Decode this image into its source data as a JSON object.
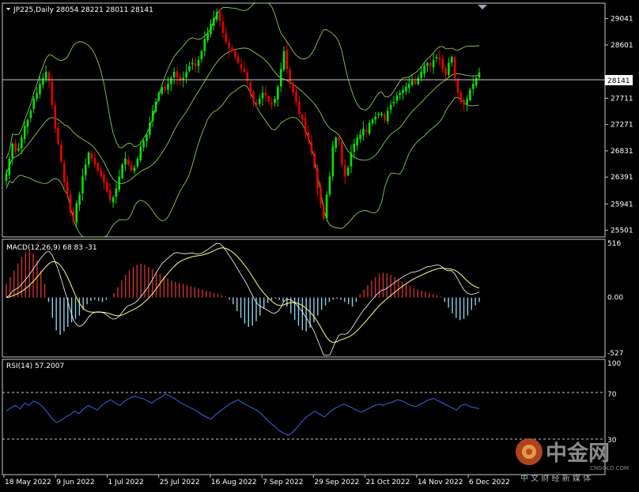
{
  "colors": {
    "background": "#000000",
    "frame": "#c8c8c8",
    "bull_candle": "#00e600",
    "bear_candle": "#e60000",
    "bollinger": "#9be05a",
    "macd_pos_hist": "#d03030",
    "macd_neg_hist": "#8ccfe6",
    "macd_signal": "#ffff7a",
    "macd_line": "#ffffff",
    "rsi_line": "#3a62e8",
    "price_line": "#c8c8c8"
  },
  "header": {
    "price": "JP225,Daily  28054 28221 28011 28141",
    "macd": "MACD(12,26,9) 68 83 -31",
    "rsi": "RSI(14) 57.2007"
  },
  "price_marker": "28141",
  "watermark": {
    "name": "中金网",
    "domain": "CNGOLD.COM",
    "tagline": "中 文 财 经 新 媒 体"
  },
  "chart_data": [
    {
      "type": "candlestick",
      "title": "JP225,Daily",
      "symbol": "JP225",
      "timeframe": "Daily",
      "last_ohlc": {
        "open": 28054,
        "high": 28221,
        "low": 28011,
        "close": 28141
      },
      "yticks": [
        "29041",
        "28601",
        "27711",
        "27271",
        "26831",
        "26391",
        "25941",
        "25501"
      ],
      "ylim": [
        25390,
        29300
      ],
      "xticks": [
        "18 May 2022",
        "9 Jun 2022",
        "1 Jul 2022",
        "25 Jul 2022",
        "16 Aug 2022",
        "7 Sep 2022",
        "29 Sep 2022",
        "21 Oct 2022",
        "14 Nov 2022",
        "6 Dec 2022"
      ],
      "closes": [
        26450,
        26700,
        26950,
        26820,
        26870,
        27050,
        27250,
        27350,
        27500,
        27700,
        27800,
        27950,
        28050,
        28150,
        28000,
        27600,
        27200,
        26950,
        26650,
        26300,
        26100,
        25800,
        25650,
        25950,
        26100,
        26400,
        26600,
        26800,
        26700,
        26600,
        26500,
        26400,
        26300,
        26150,
        26000,
        26050,
        26200,
        26400,
        26600,
        26700,
        26600,
        26500,
        26550,
        26700,
        26900,
        27000,
        27100,
        27300,
        27500,
        27650,
        27800,
        27900,
        27850,
        27950,
        28050,
        28150,
        28050,
        28000,
        28050,
        28150,
        28250,
        28300,
        28250,
        28350,
        28500,
        28700,
        28800,
        28950,
        29050,
        29150,
        29000,
        28800,
        28650,
        28550,
        28500,
        28400,
        28300,
        28200,
        28150,
        28000,
        27800,
        27650,
        27600,
        27700,
        27800,
        27750,
        27650,
        27600,
        27700,
        27900,
        28200,
        28500,
        28200,
        27950,
        27800,
        27650,
        27450,
        27350,
        27150,
        27000,
        26800,
        26550,
        26200,
        25950,
        25700,
        26100,
        26400,
        26900,
        27050,
        27000,
        26600,
        26400,
        26550,
        26800,
        26950,
        27050,
        27100,
        27200,
        27150,
        27300,
        27350,
        27400,
        27450,
        27450,
        27350,
        27500,
        27600,
        27650,
        27750,
        27800,
        27850,
        27900,
        27950,
        28000,
        27950,
        28050,
        28150,
        28250,
        28300,
        28250,
        28350,
        28400,
        28350,
        28200,
        28100,
        28300,
        28400,
        28050,
        27800,
        27650,
        27600,
        27700,
        27850,
        27950,
        28050,
        28141
      ],
      "macd_histogram": [
        120,
        180,
        240,
        300,
        360,
        400,
        420,
        390,
        330,
        240,
        120,
        -40,
        -180,
        -290,
        -330,
        -300,
        -260,
        -220,
        -190,
        -160,
        -110,
        -60,
        -30,
        -20,
        -30,
        -40,
        -20,
        0,
        40,
        90,
        150,
        200,
        240,
        270,
        290,
        300,
        290,
        270,
        250,
        230,
        210,
        190,
        170,
        150,
        140,
        130,
        120,
        110,
        100,
        90,
        80,
        70,
        60,
        50,
        40,
        30,
        20,
        10,
        -20,
        -60,
        -120,
        -180,
        -230,
        -260,
        -250,
        -210,
        -160,
        -100,
        -50,
        -20,
        -10,
        -20,
        -40,
        -80,
        -140,
        -200,
        -250,
        -290,
        -300,
        -270,
        -220,
        -160,
        -110,
        -70,
        -40,
        -20,
        -10,
        -20,
        -40,
        -60,
        -80,
        -40,
        30,
        70,
        110,
        150,
        180,
        210,
        220,
        215,
        200,
        180,
        160,
        140,
        120,
        100,
        80,
        70,
        60,
        50,
        40,
        30,
        20,
        10,
        -40,
        -90,
        -140,
        -180,
        -200,
        -190,
        -160,
        -110,
        -70,
        -40
      ],
      "rsi": {
        "values": [
          55,
          58,
          60,
          57,
          62,
          60,
          64,
          62,
          59,
          54,
          49,
          45,
          47,
          50,
          52,
          55,
          53,
          57,
          60,
          58,
          56,
          60,
          63,
          65,
          62,
          60,
          64,
          66,
          68,
          67,
          66,
          64,
          62,
          65,
          67,
          70,
          68,
          66,
          63,
          61,
          59,
          57,
          55,
          52,
          50,
          48,
          52,
          55,
          58,
          61,
          63,
          65,
          62,
          60,
          58,
          56,
          53,
          49,
          45,
          42,
          38,
          36,
          34,
          37,
          41,
          46,
          50,
          53,
          55,
          52,
          50,
          54,
          57,
          59,
          61,
          60,
          58,
          56,
          54,
          56,
          58,
          60,
          61,
          60,
          62,
          63,
          65,
          64,
          62,
          60,
          59,
          61,
          63,
          65,
          66,
          64,
          62,
          60,
          58,
          56,
          60,
          61,
          59,
          58,
          57.2
        ],
        "levels": [
          70,
          30
        ],
        "ylim": [
          0,
          100
        ],
        "ticks": [
          "100",
          "70",
          "30"
        ]
      },
      "macd": {
        "params": "12,26,9",
        "main": 68,
        "signal": 83,
        "histogram_last": -31,
        "ticks": [
          "516",
          "0.00",
          "-527"
        ]
      }
    }
  ]
}
